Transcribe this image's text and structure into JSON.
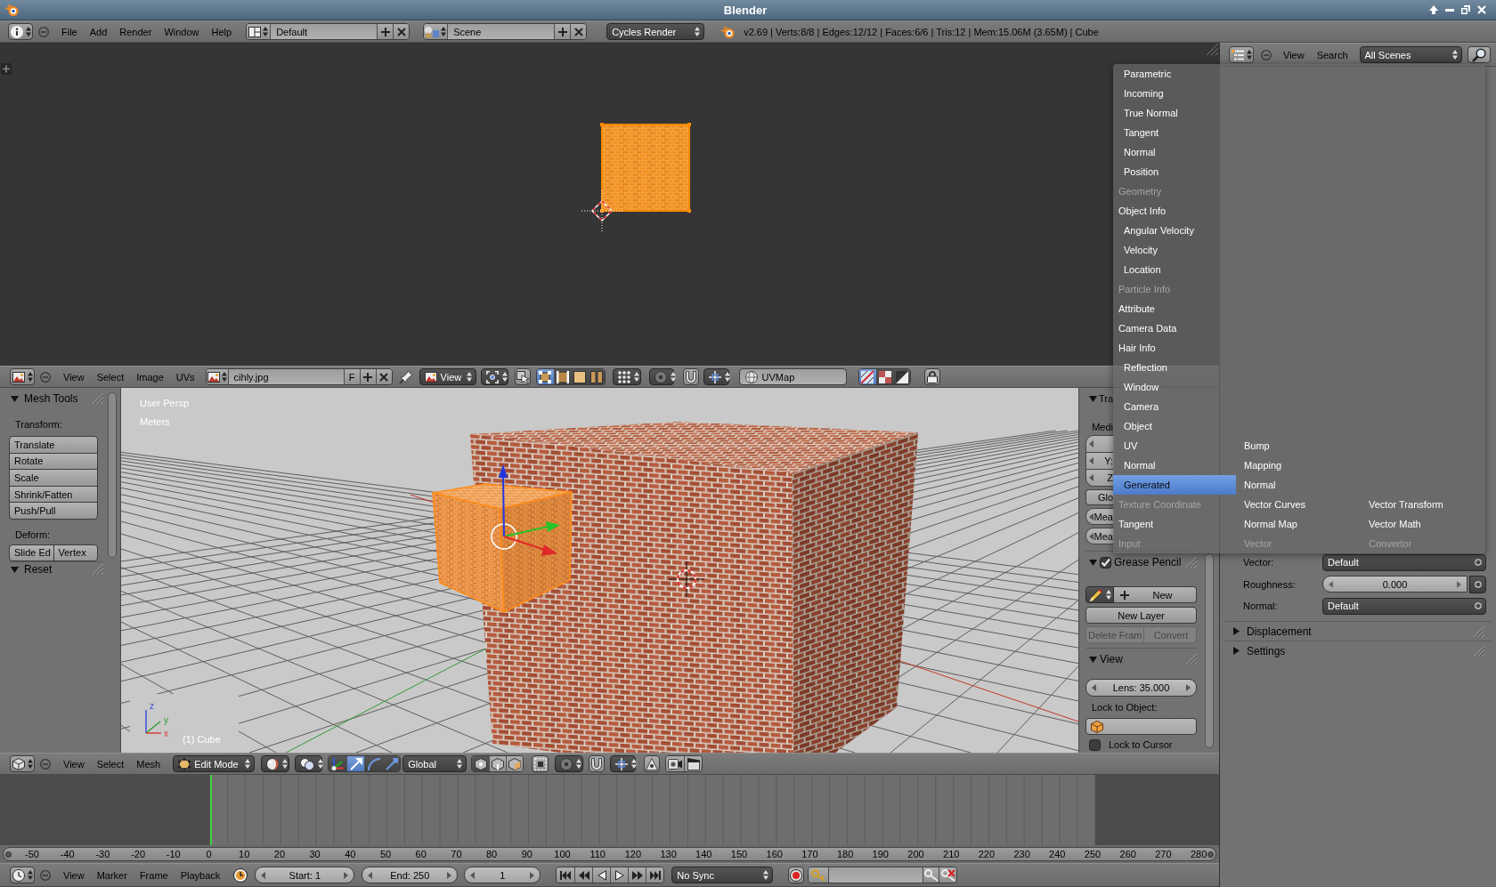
{
  "title_bar": {
    "title": "Blender"
  },
  "info_header": {
    "menus": [
      "File",
      "Add",
      "Render",
      "Window",
      "Help"
    ],
    "screen_field": "Default",
    "scene_field": "Scene",
    "render_engine": "Cycles Render",
    "stats": "v2.69 | Verts:8/8 | Edges:12/12 | Faces:6/6 | Tris:12 | Mem:15.06M (3.65M) | Cube"
  },
  "image_editor": {
    "header": {
      "menus": [
        "View",
        "Select",
        "Image",
        "UVs"
      ],
      "image_field": "cihly.jpg",
      "fake_user_button": "F",
      "view_dropdown": "View",
      "select_mode_buttons": [
        {
          "selected": true
        },
        {
          "selected": false
        },
        {
          "selected": false
        },
        {
          "selected": false
        }
      ],
      "uv_map_field": "UVMap",
      "display_toggles": [
        {
          "on": true
        },
        {
          "on": false
        },
        {
          "on": false
        }
      ]
    }
  },
  "view_3d": {
    "overlay": {
      "view_name": "User Persp",
      "units": "Meters",
      "object_label": "(1) Cube",
      "axis_labels": [
        "z",
        "y",
        "x"
      ]
    },
    "tool_shelf": {
      "panels": [
        {
          "title": "Mesh Tools",
          "expanded": true,
          "sections": [
            {
              "label": "Transform:",
              "kind": "column",
              "buttons": [
                "Translate",
                "Rotate",
                "Scale",
                "Shrink/Fatten",
                "Push/Pull"
              ]
            },
            {
              "label": "Deform:",
              "kind": "row",
              "buttons": [
                "Slide Ed",
                "Vertex"
              ]
            }
          ]
        },
        {
          "title": "Reset",
          "expanded": true
        }
      ]
    },
    "sidebar": {
      "transform": {
        "title": "Tra",
        "expanded": true,
        "median_label": "Medi",
        "coordinate_fields": [
          {
            "kind": "blank"
          },
          {
            "kind": "labeled",
            "label": "Y:"
          },
          {
            "kind": "labeled",
            "label": "Z"
          }
        ],
        "global_button": "Glo",
        "mean_fields": [
          "Mea",
          "Mea"
        ]
      },
      "grease_pencil": {
        "title": "Grease Pencil",
        "expanded": true,
        "enabled": true,
        "new_button": "New",
        "new_layer_button": "New Layer",
        "actions": [
          {
            "label": "Delete Fram",
            "disabled": true
          },
          {
            "label": "Convert",
            "disabled": true
          }
        ]
      },
      "view": {
        "title": "View",
        "expanded": true,
        "lens_field": "Lens: 35.000",
        "lock_object_label": "Lock to Object:",
        "lock_to_cursor": {
          "label": "Lock to Cursor",
          "checked": false
        }
      }
    },
    "header": {
      "menus": [
        "View",
        "Select",
        "Mesh"
      ],
      "mode_dropdown": "Edit Mode",
      "manipulator_buttons": [
        {
          "on": false
        },
        {
          "on": true
        },
        {
          "on": false
        },
        {
          "on": false
        }
      ],
      "orientation_dropdown": "Global",
      "select_mode_buttons": [
        {
          "selected": true
        },
        {
          "selected": false
        },
        {
          "selected": false
        }
      ]
    }
  },
  "timeline": {
    "ruler_labels": [
      "-50",
      "-40",
      "-30",
      "-20",
      "-10",
      "0",
      "10",
      "20",
      "30",
      "40",
      "50",
      "60",
      "70",
      "80",
      "90",
      "100",
      "110",
      "120",
      "130",
      "140",
      "150",
      "160",
      "170",
      "180",
      "190",
      "200",
      "210",
      "220",
      "230",
      "240",
      "250",
      "260",
      "270",
      "280"
    ],
    "header": {
      "menus": [
        "View",
        "Marker",
        "Frame",
        "Playback"
      ],
      "start_field": "Start: 1",
      "end_field": "End: 250",
      "current_frame_field": "1",
      "sync_dropdown": "No Sync"
    }
  },
  "outliner_header": {
    "menus": [
      "View",
      "Search"
    ],
    "filter_dropdown": "All Scenes"
  },
  "properties": {
    "inputs": [
      {
        "label": "Vector:",
        "kind": "menu",
        "value": "Default"
      },
      {
        "label": "Roughness:",
        "kind": "number",
        "value": "0.000"
      },
      {
        "label": "Normal:",
        "kind": "menu",
        "value": "Default"
      }
    ],
    "panels": [
      {
        "title": "Displacement",
        "expanded": false
      },
      {
        "title": "Settings",
        "expanded": false
      }
    ]
  },
  "add_menu": {
    "columns": [
      {
        "heading": "Input",
        "entries": [
          {
            "kind": "group",
            "label": "Geometry",
            "children": [
              {
                "label": "Parametric",
                "selected": false
              },
              {
                "label": "Incoming",
                "selected": false
              },
              {
                "label": "True Normal",
                "selected": false
              },
              {
                "label": "Tangent",
                "selected": false
              },
              {
                "label": "Normal",
                "selected": false
              },
              {
                "label": "Position",
                "selected": false
              }
            ]
          },
          {
            "kind": "item",
            "label": "Object Info",
            "selected": false
          },
          {
            "kind": "group",
            "label": "Particle Info",
            "children": [
              {
                "label": "Angular Velocity",
                "selected": false
              },
              {
                "label": "Velocity",
                "selected": false
              },
              {
                "label": "Location",
                "selected": false
              }
            ]
          },
          {
            "kind": "item",
            "label": "Attribute",
            "selected": false
          },
          {
            "kind": "item",
            "label": "Camera Data",
            "selected": false
          },
          {
            "kind": "item",
            "label": "Hair Info",
            "selected": false
          },
          {
            "kind": "group",
            "label": "Texture Coordinate",
            "children": [
              {
                "label": "Reflection",
                "selected": false
              },
              {
                "label": "Window",
                "selected": false
              },
              {
                "label": "Camera",
                "selected": false
              },
              {
                "label": "Object",
                "selected": false
              },
              {
                "label": "UV",
                "selected": false
              },
              {
                "label": "Normal",
                "selected": false
              },
              {
                "label": "Generated",
                "selected": true
              }
            ]
          },
          {
            "kind": "item",
            "label": "Tangent",
            "selected": false
          }
        ]
      },
      {
        "heading": "Vector",
        "entries": [
          {
            "kind": "item",
            "label": "Bump",
            "selected": false
          },
          {
            "kind": "item",
            "label": "Mapping",
            "selected": false
          },
          {
            "kind": "item",
            "label": "Normal",
            "selected": false
          },
          {
            "kind": "item",
            "label": "Vector Curves",
            "selected": false
          },
          {
            "kind": "item",
            "label": "Normal Map",
            "selected": false
          }
        ]
      },
      {
        "heading": "Convertor",
        "entries": [
          {
            "kind": "item",
            "label": "Vector Transform",
            "selected": false
          },
          {
            "kind": "item",
            "label": "Vector Math",
            "selected": false
          }
        ]
      }
    ]
  }
}
